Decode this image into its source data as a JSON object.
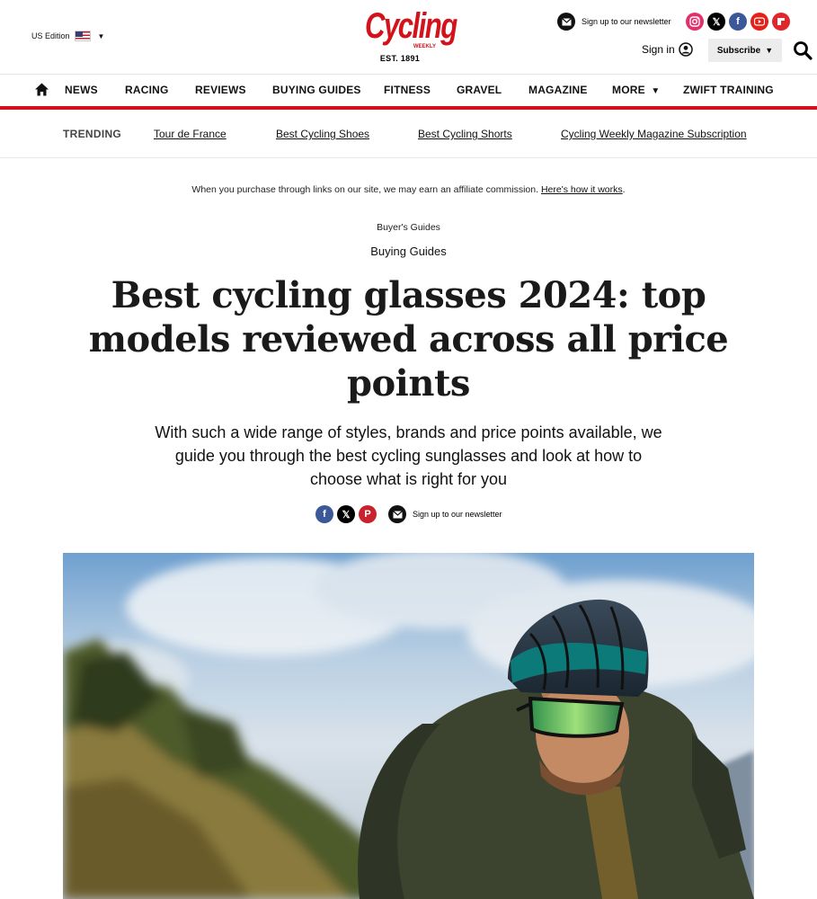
{
  "header": {
    "edition_label": "US Edition",
    "edition_flag_icon": "us-flag-icon",
    "logo": {
      "wordmark": "Cycling",
      "weekly": "WEEKLY",
      "est": "EST. 1891"
    },
    "newsletter_label": "Sign up to our newsletter",
    "socials": [
      "instagram-icon",
      "x-icon",
      "facebook-icon",
      "youtube-icon",
      "flipboard-icon"
    ],
    "signin_label": "Sign in",
    "subscribe_label": "Subscribe"
  },
  "nav": {
    "items": [
      {
        "label": "NEWS"
      },
      {
        "label": "RACING"
      },
      {
        "label": "REVIEWS"
      },
      {
        "label": "BUYING GUIDES"
      },
      {
        "label": "FITNESS"
      },
      {
        "label": "GRAVEL"
      },
      {
        "label": "MAGAZINE"
      },
      {
        "label": "MORE"
      },
      {
        "label": "ZWIFT TRAINING"
      }
    ]
  },
  "trending": {
    "label": "TRENDING",
    "links": [
      "Tour de France",
      "Best Cycling Shoes",
      "Best Cycling Shorts",
      "Cycling Weekly Magazine Subscription"
    ]
  },
  "article": {
    "affiliate_text": "When you purchase through links on our site, we may earn an affiliate commission.",
    "affiliate_link": "Here's how it works",
    "affiliate_end": ".",
    "breadcrumb_primary": "Buyer's Guides",
    "breadcrumb_secondary": "Buying Guides",
    "headline": "Best cycling glasses 2024: top models reviewed across all price points",
    "strapline": "With such a wide range of styles, brands and price points available, we guide you through the best cycling sunglasses and look at how to choose what is right for you",
    "share_icons": [
      "facebook-icon",
      "x-icon",
      "pinterest-icon"
    ],
    "share_newsletter_label": "Sign up to our newsletter"
  },
  "colors": {
    "brand_red": "#d3131c",
    "text": "#111111"
  }
}
